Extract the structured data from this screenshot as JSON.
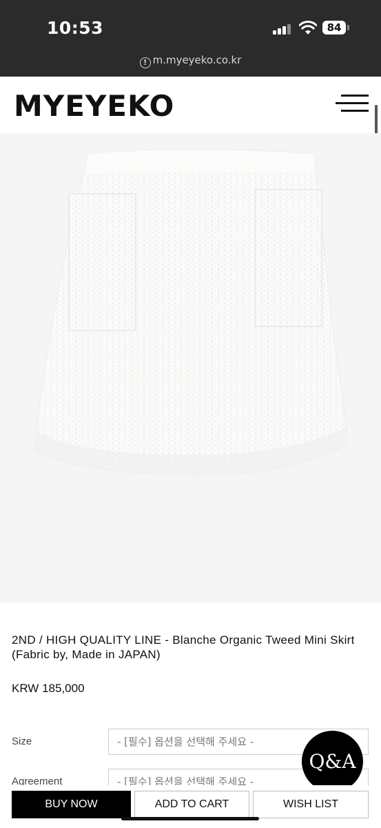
{
  "status_bar": {
    "time": "10:53",
    "battery": "84",
    "url": "m.myeyeko.co.kr",
    "url_icon": "!"
  },
  "header": {
    "logo": "MYEYEKO",
    "menu_icon": "hamburger-menu-icon"
  },
  "product": {
    "image_alt": "white tweed mini skirt",
    "title": "2ND / HIGH QUALITY LINE - Blanche Organic Tweed Mini Skirt (Fabric by, Made in JAPAN)",
    "price": "KRW 185,000"
  },
  "options": [
    {
      "label": "Size",
      "placeholder": "- [필수] 옵션을 선택해 주세요 -"
    },
    {
      "label": "Agreement",
      "placeholder": "- [필수] 옵션을 선택해 주세요 -"
    }
  ],
  "qa_button": "Q&A",
  "actions": {
    "buy_now": "BUY NOW",
    "add_to_cart": "ADD TO CART",
    "wish_list": "WISH LIST"
  },
  "colors": {
    "status_bar_bg": "#2b2b2b",
    "image_bg": "#f5f5f5",
    "primary_button": "#000000"
  }
}
